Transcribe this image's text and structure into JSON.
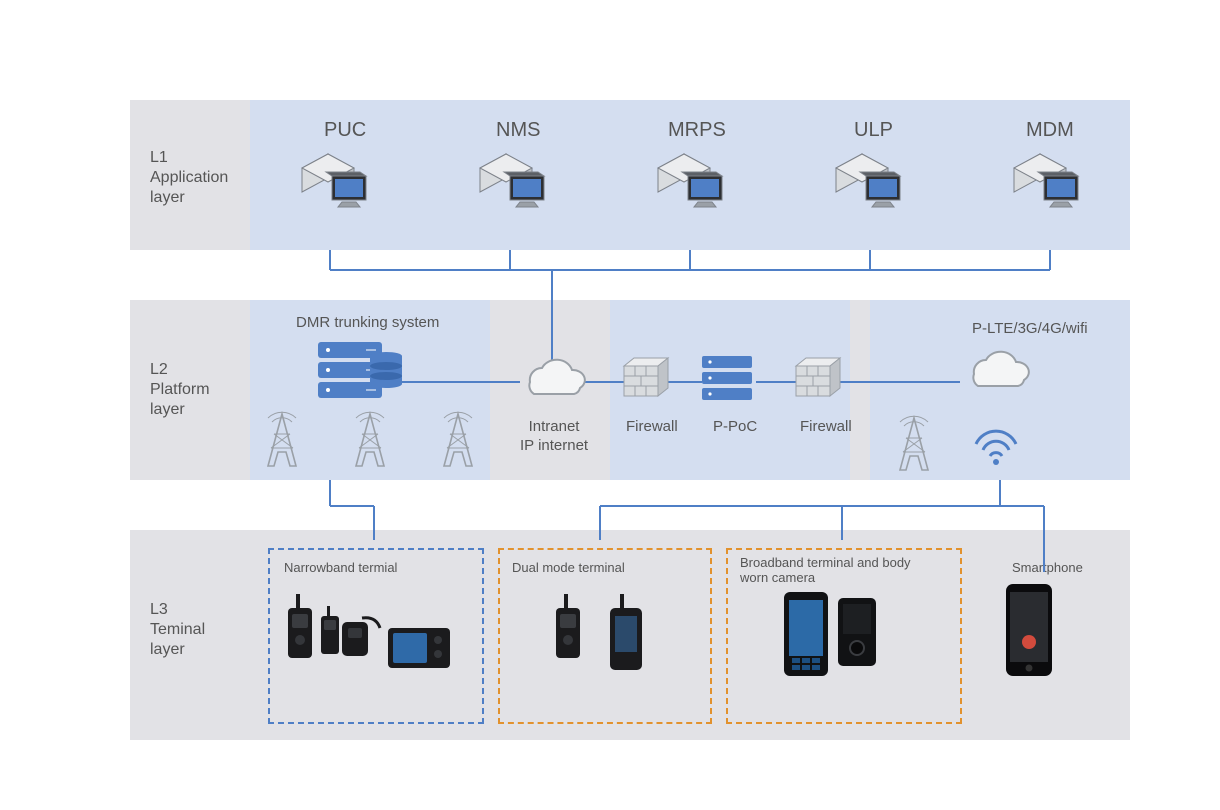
{
  "layers": {
    "l1": "L1\nApplication\nlayer",
    "l2": "L2\nPlatform\nlayer",
    "l3": "L3\nTeminal\nlayer"
  },
  "apps": [
    "PUC",
    "NMS",
    "MRPS",
    "ULP",
    "MDM"
  ],
  "platform": {
    "dmr": "DMR trunking system",
    "intranet": "Intranet\nIP internet",
    "fw1": "Firewall",
    "ppoc": "P-PoC",
    "fw2": "Firewall",
    "wan": "P-LTE/3G/4G/wifi"
  },
  "terminals": {
    "narrow": "Narrowband termial",
    "dual": "Dual mode terminal",
    "bbcam": "Broadband terminal and body\nworn camera",
    "phone": "Smartphone"
  },
  "colors": {
    "blue": "#4f7fc6",
    "orange": "#e2922e",
    "grey": "#9aa0a7",
    "lightgrey": "#d9dcdf",
    "bandblue": "#d4def0"
  }
}
